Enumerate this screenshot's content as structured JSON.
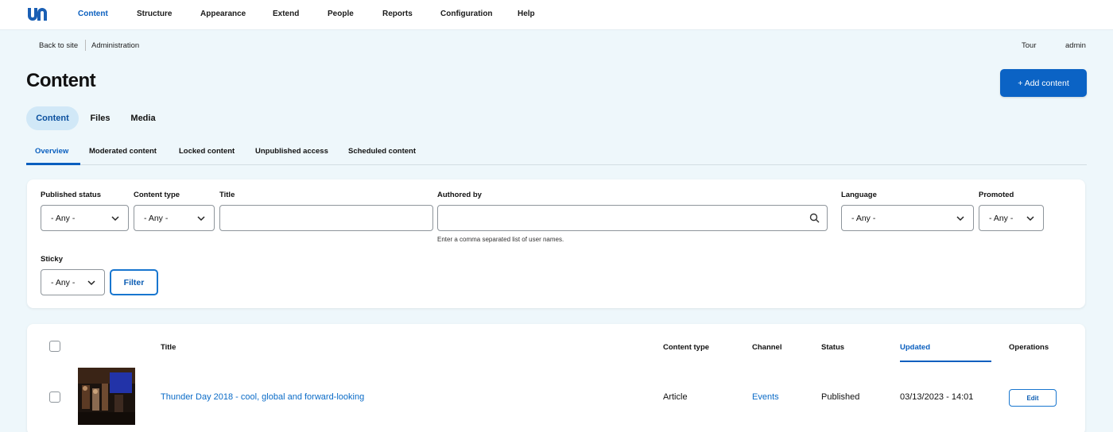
{
  "nav": {
    "items": [
      "Content",
      "Structure",
      "Appearance",
      "Extend",
      "People",
      "Reports",
      "Configuration",
      "Help"
    ]
  },
  "breadcrumb": {
    "back": "Back to site",
    "admin": "Administration",
    "tour": "Tour",
    "user": "admin"
  },
  "page": {
    "title": "Content",
    "add_button": "+ Add content"
  },
  "primary_tabs": [
    "Content",
    "Files",
    "Media"
  ],
  "secondary_tabs": [
    "Overview",
    "Moderated content",
    "Locked content",
    "Unpublished access",
    "Scheduled content"
  ],
  "filters": {
    "published_status": {
      "label": "Published status",
      "value": "- Any -"
    },
    "content_type": {
      "label": "Content type",
      "value": "- Any -"
    },
    "title": {
      "label": "Title",
      "value": ""
    },
    "authored_by": {
      "label": "Authored by",
      "value": "",
      "help": "Enter a comma separated list of user names."
    },
    "language": {
      "label": "Language",
      "value": "- Any -"
    },
    "promoted": {
      "label": "Promoted",
      "value": "- Any -"
    },
    "sticky": {
      "label": "Sticky",
      "value": "- Any -"
    },
    "filter_button": "Filter"
  },
  "table": {
    "headers": {
      "title": "Title",
      "content_type": "Content type",
      "channel": "Channel",
      "status": "Status",
      "updated": "Updated",
      "operations": "Operations"
    },
    "rows": [
      {
        "title": "Thunder Day 2018 - cool, global and forward-looking",
        "content_type": "Article",
        "channel": "Events",
        "status": "Published",
        "updated": "03/13/2023 - 14:01",
        "operation": "Edit"
      }
    ]
  },
  "colors": {
    "accent": "#0b63c5",
    "background": "#eef7fb",
    "link": "#0a6bc7"
  }
}
